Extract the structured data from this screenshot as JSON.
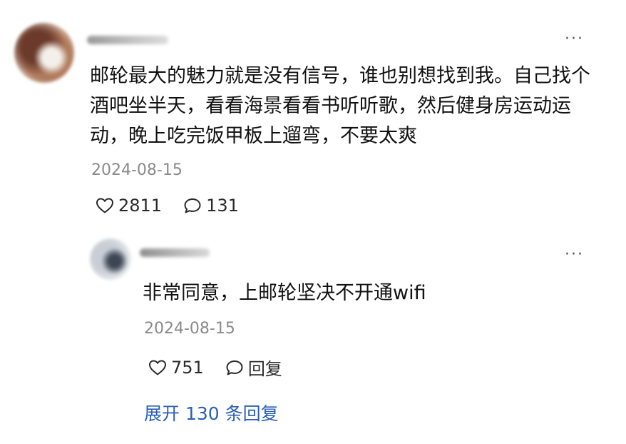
{
  "comment": {
    "text": "邮轮最大的魅力就是没有信号，谁也别想找到我。自己找个酒吧坐半天，看看海景看看书听听歌，然后健身房运动运动，晚上吃完饭甲板上遛弯，不要太爽",
    "date": "2024-08-15",
    "likes": "2811",
    "replies_count": "131",
    "more_label": "···",
    "like_icon": "heart-icon",
    "reply_icon": "comment-bubble-icon"
  },
  "reply": {
    "text": "非常同意，上邮轮坚决不开通wifi",
    "date": "2024-08-15",
    "likes": "751",
    "reply_label": "回复",
    "more_label": "···"
  },
  "expand_label": "展开 130 条回复",
  "colors": {
    "link": "#2a5fb8",
    "date": "#8a8a8a",
    "text": "#111111"
  }
}
